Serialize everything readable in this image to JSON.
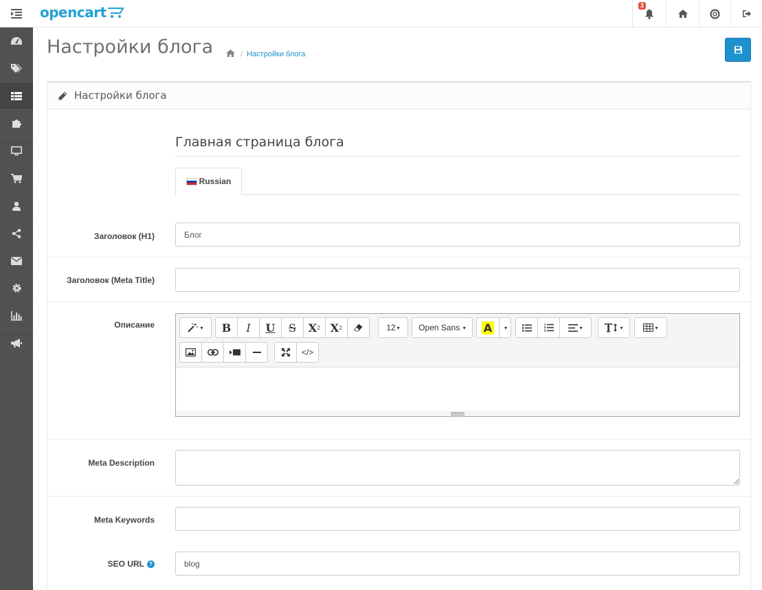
{
  "header": {
    "logo_text": "opencart",
    "notification_count": "3"
  },
  "page": {
    "title": "Настройки блога",
    "breadcrumb_link": "Настройки блога"
  },
  "panel": {
    "title": "Настройки блога",
    "section_title": "Главная страница блога",
    "language_tab": "Russian"
  },
  "form": {
    "h1_label": "Заголовок (H1)",
    "h1_value": "Блог",
    "meta_title_label": "Заголовок (Meta Title)",
    "meta_title_value": "",
    "description_label": "Описание",
    "meta_description_label": "Meta Description",
    "meta_description_value": "",
    "meta_keywords_label": "Meta Keywords",
    "meta_keywords_value": "",
    "seo_url_label": "SEO URL",
    "seo_url_value": "blog"
  },
  "editor": {
    "font_size": "12",
    "font_family": "Open Sans",
    "bold": "B",
    "italic": "I",
    "underline": "U",
    "strikethrough": "S",
    "superscript": "X",
    "subscript": "X",
    "color": "A",
    "codeview": "</>"
  },
  "colors": {
    "accent": "#1e91cf",
    "sidebar": "#515151",
    "badge": "#e3503e"
  },
  "icons": {
    "sidebar": [
      "dashboard-icon",
      "tags-icon",
      "list-icon",
      "puzzle-icon",
      "monitor-icon",
      "cart-icon",
      "user-icon",
      "share-icon",
      "envelope-icon",
      "gear-icon",
      "bar-chart-icon",
      "bullhorn-icon"
    ]
  }
}
